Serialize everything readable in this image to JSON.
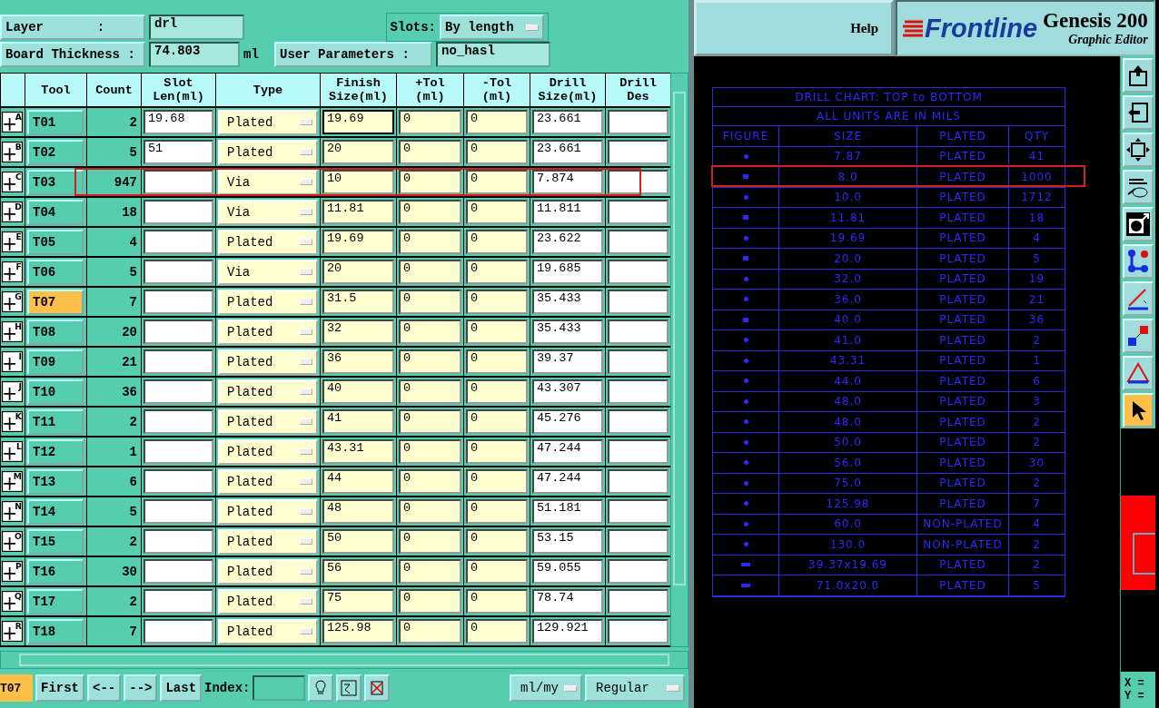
{
  "form": {
    "layer_label": "Layer       :",
    "layer": "drl",
    "slots_label": "Slots:",
    "slots": "By length",
    "thickness_label": "Board Thickness :",
    "thickness": "74.803",
    "thickness_unit": "ml",
    "user_params_label": "User Parameters :",
    "user_params": "no_hasl"
  },
  "table": {
    "columns": [
      "Tool",
      "Count",
      "Slot\nLen(ml)",
      "Type",
      "Finish\nSize(ml)",
      "+Tol\n(ml)",
      "-Tol\n(ml)",
      "Drill\nSize(ml)",
      "Drill\nDes"
    ],
    "rows": [
      {
        "letter": "A",
        "tool": "T01",
        "count": "2",
        "slot": "19.68",
        "type": "Plated",
        "finish": "19.69",
        "plus": "0",
        "minus": "0",
        "drill": "23.661",
        "focused": true,
        "selected": false,
        "highlighted": false
      },
      {
        "letter": "B",
        "tool": "T02",
        "count": "5",
        "slot": "51",
        "type": "Plated",
        "finish": "20",
        "plus": "0",
        "minus": "0",
        "drill": "23.661",
        "focused": false,
        "selected": false,
        "highlighted": false
      },
      {
        "letter": "C",
        "tool": "T03",
        "count": "947",
        "slot": "",
        "type": "Via",
        "finish": "10",
        "plus": "0",
        "minus": "0",
        "drill": "7.874",
        "focused": false,
        "selected": false,
        "highlighted": true
      },
      {
        "letter": "D",
        "tool": "T04",
        "count": "18",
        "slot": "",
        "type": "Via",
        "finish": "11.81",
        "plus": "0",
        "minus": "0",
        "drill": "11.811",
        "focused": false,
        "selected": false,
        "highlighted": false
      },
      {
        "letter": "E",
        "tool": "T05",
        "count": "4",
        "slot": "",
        "type": "Plated",
        "finish": "19.69",
        "plus": "0",
        "minus": "0",
        "drill": "23.622",
        "focused": false,
        "selected": false,
        "highlighted": false
      },
      {
        "letter": "F",
        "tool": "T06",
        "count": "5",
        "slot": "",
        "type": "Via",
        "finish": "20",
        "plus": "0",
        "minus": "0",
        "drill": "19.685",
        "focused": false,
        "selected": false,
        "highlighted": false
      },
      {
        "letter": "G",
        "tool": "T07",
        "count": "7",
        "slot": "",
        "type": "Plated",
        "finish": "31.5",
        "plus": "0",
        "minus": "0",
        "drill": "35.433",
        "focused": false,
        "selected": true,
        "highlighted": false
      },
      {
        "letter": "H",
        "tool": "T08",
        "count": "20",
        "slot": "",
        "type": "Plated",
        "finish": "32",
        "plus": "0",
        "minus": "0",
        "drill": "35.433",
        "focused": false,
        "selected": false,
        "highlighted": false
      },
      {
        "letter": "I",
        "tool": "T09",
        "count": "21",
        "slot": "",
        "type": "Plated",
        "finish": "36",
        "plus": "0",
        "minus": "0",
        "drill": "39.37",
        "focused": false,
        "selected": false,
        "highlighted": false
      },
      {
        "letter": "J",
        "tool": "T10",
        "count": "36",
        "slot": "",
        "type": "Plated",
        "finish": "40",
        "plus": "0",
        "minus": "0",
        "drill": "43.307",
        "focused": false,
        "selected": false,
        "highlighted": false
      },
      {
        "letter": "K",
        "tool": "T11",
        "count": "2",
        "slot": "",
        "type": "Plated",
        "finish": "41",
        "plus": "0",
        "minus": "0",
        "drill": "45.276",
        "focused": false,
        "selected": false,
        "highlighted": false
      },
      {
        "letter": "L",
        "tool": "T12",
        "count": "1",
        "slot": "",
        "type": "Plated",
        "finish": "43.31",
        "plus": "0",
        "minus": "0",
        "drill": "47.244",
        "focused": false,
        "selected": false,
        "highlighted": false
      },
      {
        "letter": "M",
        "tool": "T13",
        "count": "6",
        "slot": "",
        "type": "Plated",
        "finish": "44",
        "plus": "0",
        "minus": "0",
        "drill": "47.244",
        "focused": false,
        "selected": false,
        "highlighted": false
      },
      {
        "letter": "N",
        "tool": "T14",
        "count": "5",
        "slot": "",
        "type": "Plated",
        "finish": "48",
        "plus": "0",
        "minus": "0",
        "drill": "51.181",
        "focused": false,
        "selected": false,
        "highlighted": false
      },
      {
        "letter": "O",
        "tool": "T15",
        "count": "2",
        "slot": "",
        "type": "Plated",
        "finish": "50",
        "plus": "0",
        "minus": "0",
        "drill": "53.15",
        "focused": false,
        "selected": false,
        "highlighted": false
      },
      {
        "letter": "P",
        "tool": "T16",
        "count": "30",
        "slot": "",
        "type": "Plated",
        "finish": "56",
        "plus": "0",
        "minus": "0",
        "drill": "59.055",
        "focused": false,
        "selected": false,
        "highlighted": false
      },
      {
        "letter": "Q",
        "tool": "T17",
        "count": "2",
        "slot": "",
        "type": "Plated",
        "finish": "75",
        "plus": "0",
        "minus": "0",
        "drill": "78.74",
        "focused": false,
        "selected": false,
        "highlighted": false
      },
      {
        "letter": "R",
        "tool": "T18",
        "count": "7",
        "slot": "",
        "type": "Plated",
        "finish": "125.98",
        "plus": "0",
        "minus": "0",
        "drill": "129.921",
        "focused": false,
        "selected": false,
        "highlighted": false
      }
    ]
  },
  "bottom_bar": {
    "current": "T07",
    "buttons": [
      "First",
      "<--",
      "-->",
      "Last"
    ],
    "index_label": "Index:",
    "units": "ml/my",
    "mode": "Regular"
  },
  "header": {
    "help": "Help",
    "logo": "Frontline",
    "product": "Genesis 200",
    "subtitle": "Graphic Editor"
  },
  "drill_chart": {
    "title": "DRILL CHART: TOP to BOTTOM",
    "subtitle": "ALL UNITS ARE IN MILS",
    "columns": [
      "FIGURE",
      "SIZE",
      "PLATED",
      "QTY"
    ],
    "rows": [
      {
        "kind": "round",
        "size": "7.87",
        "plated": "PLATED",
        "qty": "41",
        "highlighted": false
      },
      {
        "kind": "square",
        "size": "8.0",
        "plated": "PLATED",
        "qty": "1000",
        "highlighted": true
      },
      {
        "kind": "round",
        "size": "10.0",
        "plated": "PLATED",
        "qty": "1712",
        "highlighted": false
      },
      {
        "kind": "square",
        "size": "11.81",
        "plated": "PLATED",
        "qty": "18",
        "highlighted": false
      },
      {
        "kind": "round",
        "size": "19.69",
        "plated": "PLATED",
        "qty": "4",
        "highlighted": false
      },
      {
        "kind": "square",
        "size": "20.0",
        "plated": "PLATED",
        "qty": "5",
        "highlighted": false
      },
      {
        "kind": "round",
        "size": "32.0",
        "plated": "PLATED",
        "qty": "19",
        "highlighted": false
      },
      {
        "kind": "round",
        "size": "36.0",
        "plated": "PLATED",
        "qty": "21",
        "highlighted": false
      },
      {
        "kind": "square",
        "size": "40.0",
        "plated": "PLATED",
        "qty": "36",
        "highlighted": false
      },
      {
        "kind": "round",
        "size": "41.0",
        "plated": "PLATED",
        "qty": "2",
        "highlighted": false
      },
      {
        "kind": "round",
        "size": "43.31",
        "plated": "PLATED",
        "qty": "1",
        "highlighted": false
      },
      {
        "kind": "round",
        "size": "44.0",
        "plated": "PLATED",
        "qty": "6",
        "highlighted": false
      },
      {
        "kind": "round",
        "size": "48.0",
        "plated": "PLATED",
        "qty": "3",
        "highlighted": false
      },
      {
        "kind": "round",
        "size": "48.0",
        "plated": "PLATED",
        "qty": "2",
        "highlighted": false
      },
      {
        "kind": "round",
        "size": "50.0",
        "plated": "PLATED",
        "qty": "2",
        "highlighted": false
      },
      {
        "kind": "round",
        "size": "56.0",
        "plated": "PLATED",
        "qty": "30",
        "highlighted": false
      },
      {
        "kind": "round",
        "size": "75.0",
        "plated": "PLATED",
        "qty": "2",
        "highlighted": false
      },
      {
        "kind": "round",
        "size": "125.98",
        "plated": "PLATED",
        "qty": "7",
        "highlighted": false
      },
      {
        "kind": "round",
        "size": "60.0",
        "plated": "NON-PLATED",
        "qty": "4",
        "highlighted": false
      },
      {
        "kind": "round",
        "size": "130.0",
        "plated": "NON-PLATED",
        "qty": "2",
        "highlighted": false
      },
      {
        "kind": "slot",
        "size": "39.37x19.69",
        "plated": "PLATED",
        "qty": "2",
        "highlighted": false
      },
      {
        "kind": "slot",
        "size": "71.0x20.0",
        "plated": "PLATED",
        "qty": "5",
        "highlighted": false
      }
    ]
  },
  "toolbar": [
    {
      "kind": "export",
      "selected": false
    },
    {
      "kind": "import",
      "selected": false
    },
    {
      "kind": "fit",
      "selected": false
    },
    {
      "kind": "tools",
      "selected": false
    },
    {
      "kind": "shape",
      "selected": false
    },
    {
      "kind": "nodes",
      "selected": false
    },
    {
      "kind": "line",
      "selected": false
    },
    {
      "kind": "move",
      "selected": false
    },
    {
      "kind": "triangle",
      "selected": false
    },
    {
      "kind": "pointer",
      "selected": true
    }
  ],
  "coords": {
    "x_label": "X =",
    "y_label": "Y ="
  }
}
